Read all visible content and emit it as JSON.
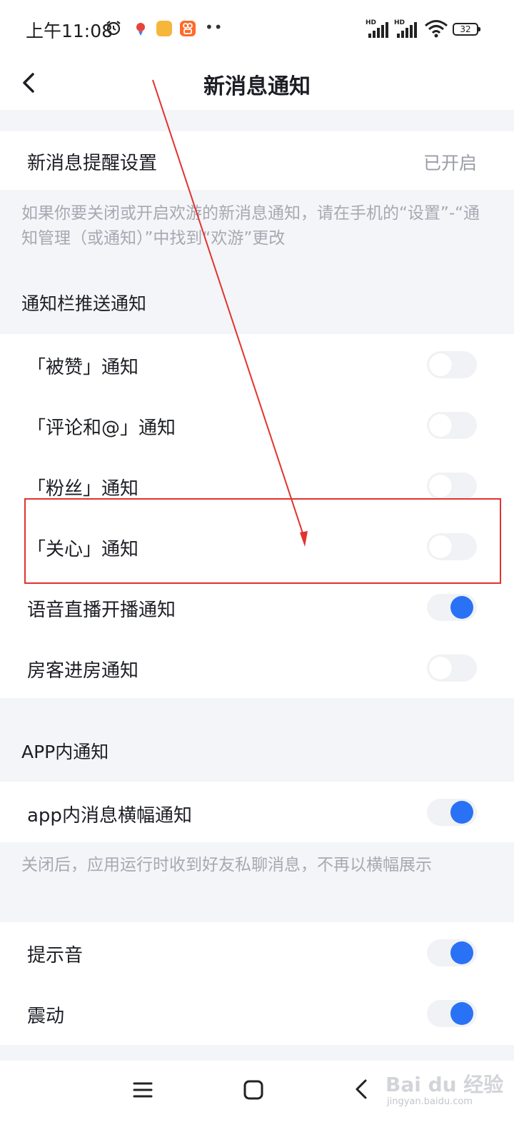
{
  "status_bar": {
    "time": "上午11:08",
    "signal_label": "HD",
    "battery": "32"
  },
  "header": {
    "title": "新消息通知"
  },
  "reminder": {
    "label": "新消息提醒设置",
    "value": "已开启",
    "description": "如果你要关闭或开启欢游的新消息通知，请在手机的“设置”-“通知管理（或通知）”中找到“欢游”更改"
  },
  "push_section": {
    "title": "通知栏推送通知",
    "items": [
      {
        "label": "「被赞」通知",
        "enabled": false
      },
      {
        "label": "「评论和@」通知",
        "enabled": false
      },
      {
        "label": "「粉丝」通知",
        "enabled": false
      },
      {
        "label": "「关心」通知",
        "enabled": false
      },
      {
        "label": "语音直播开播通知",
        "enabled": true
      },
      {
        "label": "房客进房通知",
        "enabled": false
      }
    ]
  },
  "app_section": {
    "title": "APP内通知",
    "banner": {
      "label": "app内消息横幅通知",
      "enabled": true
    },
    "banner_description": "关闭后，应用运行时收到好友私聊消息，不再以横幅展示",
    "items": [
      {
        "label": "提示音",
        "enabled": true
      },
      {
        "label": "震动",
        "enabled": true
      }
    ]
  },
  "watermark": {
    "main": "Bai du 经验",
    "sub": "jingyan.baidu.com"
  },
  "colors": {
    "accent": "#2a72f5",
    "highlight": "#e2332e"
  }
}
